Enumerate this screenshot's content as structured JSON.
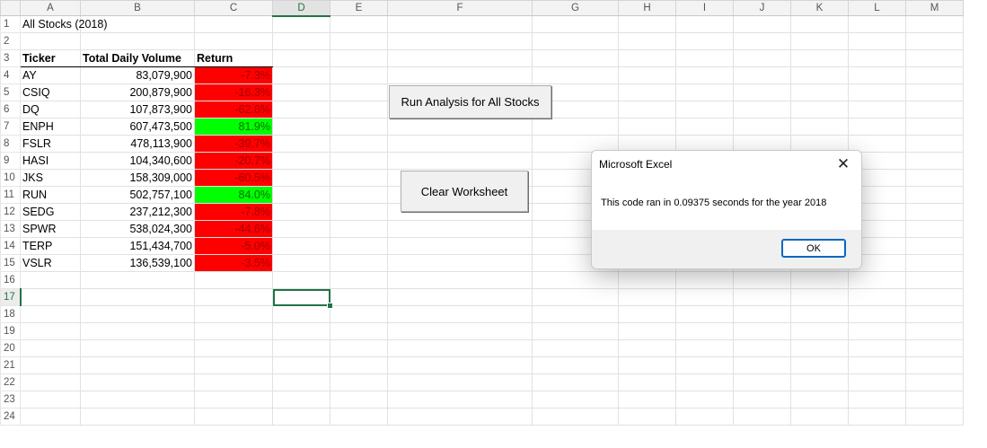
{
  "columns": [
    "A",
    "B",
    "C",
    "D",
    "E",
    "F",
    "G",
    "H",
    "I",
    "J",
    "K",
    "L",
    "M"
  ],
  "selected_column": "D",
  "selected_row": 17,
  "sheet": {
    "title": "All Stocks (2018)",
    "headers": {
      "ticker": "Ticker",
      "volume": "Total Daily Volume",
      "return": "Return"
    },
    "rows": [
      {
        "ticker": "AY",
        "volume": "83,079,900",
        "return": "-7.3%",
        "status": "neg"
      },
      {
        "ticker": "CSIQ",
        "volume": "200,879,900",
        "return": "-16.3%",
        "status": "neg"
      },
      {
        "ticker": "DQ",
        "volume": "107,873,900",
        "return": "-62.6%",
        "status": "neg"
      },
      {
        "ticker": "ENPH",
        "volume": "607,473,500",
        "return": "81.9%",
        "status": "pos"
      },
      {
        "ticker": "FSLR",
        "volume": "478,113,900",
        "return": "-39.7%",
        "status": "neg"
      },
      {
        "ticker": "HASI",
        "volume": "104,340,600",
        "return": "-20.7%",
        "status": "neg"
      },
      {
        "ticker": "JKS",
        "volume": "158,309,000",
        "return": "-60.5%",
        "status": "neg"
      },
      {
        "ticker": "RUN",
        "volume": "502,757,100",
        "return": "84.0%",
        "status": "pos"
      },
      {
        "ticker": "SEDG",
        "volume": "237,212,300",
        "return": "-7.8%",
        "status": "neg"
      },
      {
        "ticker": "SPWR",
        "volume": "538,024,300",
        "return": "-44.6%",
        "status": "neg"
      },
      {
        "ticker": "TERP",
        "volume": "151,434,700",
        "return": "-5.0%",
        "status": "neg"
      },
      {
        "ticker": "VSLR",
        "volume": "136,539,100",
        "return": "-3.5%",
        "status": "neg"
      }
    ]
  },
  "buttons": {
    "run_all": "Run Analysis for All Stocks",
    "clear": "Clear Worksheet"
  },
  "dialog": {
    "title": "Microsoft Excel",
    "message": "This code ran in 0.09375 seconds for the year 2018",
    "ok": "OK",
    "close_glyph": "✕"
  },
  "colors": {
    "negative_fill": "#ff0000",
    "positive_fill": "#00ff00",
    "selection_green": "#217346"
  }
}
